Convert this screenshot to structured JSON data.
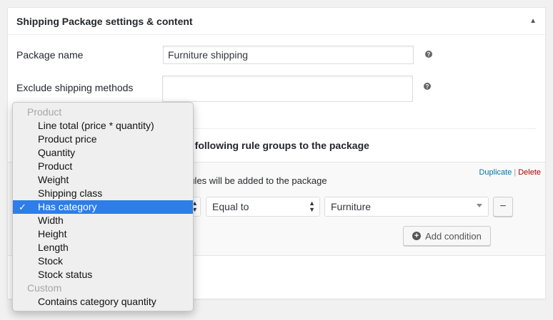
{
  "panel": {
    "title": "Shipping Package settings & content",
    "toggle_icon": "triangle-up-icon"
  },
  "form": {
    "package_name_label": "Package name",
    "package_name_value": "Furniture shipping",
    "exclude_label": "Exclude shipping methods",
    "exclude_value": "",
    "help_glyph": "?"
  },
  "rules": {
    "heading": "e following rule groups to the package",
    "group_desc": "rules will be added to the package",
    "duplicate": "Duplicate",
    "separator": "|",
    "delete": "Delete",
    "operator_value": "Equal to",
    "value_value": "Furniture",
    "remove_label": "−",
    "add_condition": "Add condition",
    "add_icon_glyph": "+"
  },
  "dropdown": {
    "check": "✓",
    "items": [
      {
        "label": "Product",
        "type": "group"
      },
      {
        "label": "Line total (price * quantity)",
        "type": "option"
      },
      {
        "label": "Product price",
        "type": "option"
      },
      {
        "label": "Quantity",
        "type": "option"
      },
      {
        "label": "Product",
        "type": "option"
      },
      {
        "label": "Weight",
        "type": "option"
      },
      {
        "label": "Shipping class",
        "type": "option"
      },
      {
        "label": "Has category",
        "type": "option",
        "selected": true
      },
      {
        "label": "Width",
        "type": "option"
      },
      {
        "label": "Height",
        "type": "option"
      },
      {
        "label": "Length",
        "type": "option"
      },
      {
        "label": "Stock",
        "type": "option"
      },
      {
        "label": "Stock status",
        "type": "option"
      },
      {
        "label": "Custom",
        "type": "group"
      },
      {
        "label": "Contains category quantity",
        "type": "option"
      }
    ]
  },
  "colors": {
    "selected": "#2e7de8",
    "link": "#0073aa",
    "delete": "#aa0000"
  }
}
